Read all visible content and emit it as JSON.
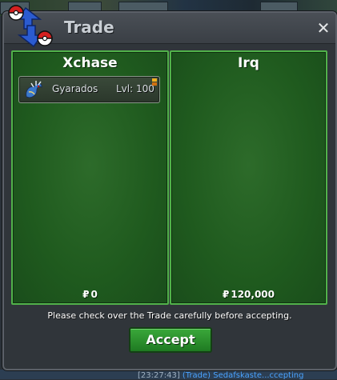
{
  "window": {
    "title": "Trade",
    "close_label": "✕"
  },
  "left_panel": {
    "player": "Xchase",
    "currency_symbol": "₽",
    "money": "0",
    "items": [
      {
        "name": "Gyarados",
        "level": "Lvl: 100",
        "icon": "gyarados-sprite-icon"
      }
    ]
  },
  "right_panel": {
    "player": "Irq",
    "currency_symbol": "₽",
    "money": "120,000",
    "items": []
  },
  "notice": "Please check over the Trade carefully before accepting.",
  "accept_label": "Accept",
  "chat_snippet": {
    "time": "[23:27:43]",
    "channel": "(Trade)",
    "text": "Sedafskaste...ccepting"
  },
  "colors": {
    "panel_green": "#1f5a1e",
    "panel_border": "#51b24a",
    "accept_green": "#2a8f2c",
    "window_bg": "#30353a"
  }
}
